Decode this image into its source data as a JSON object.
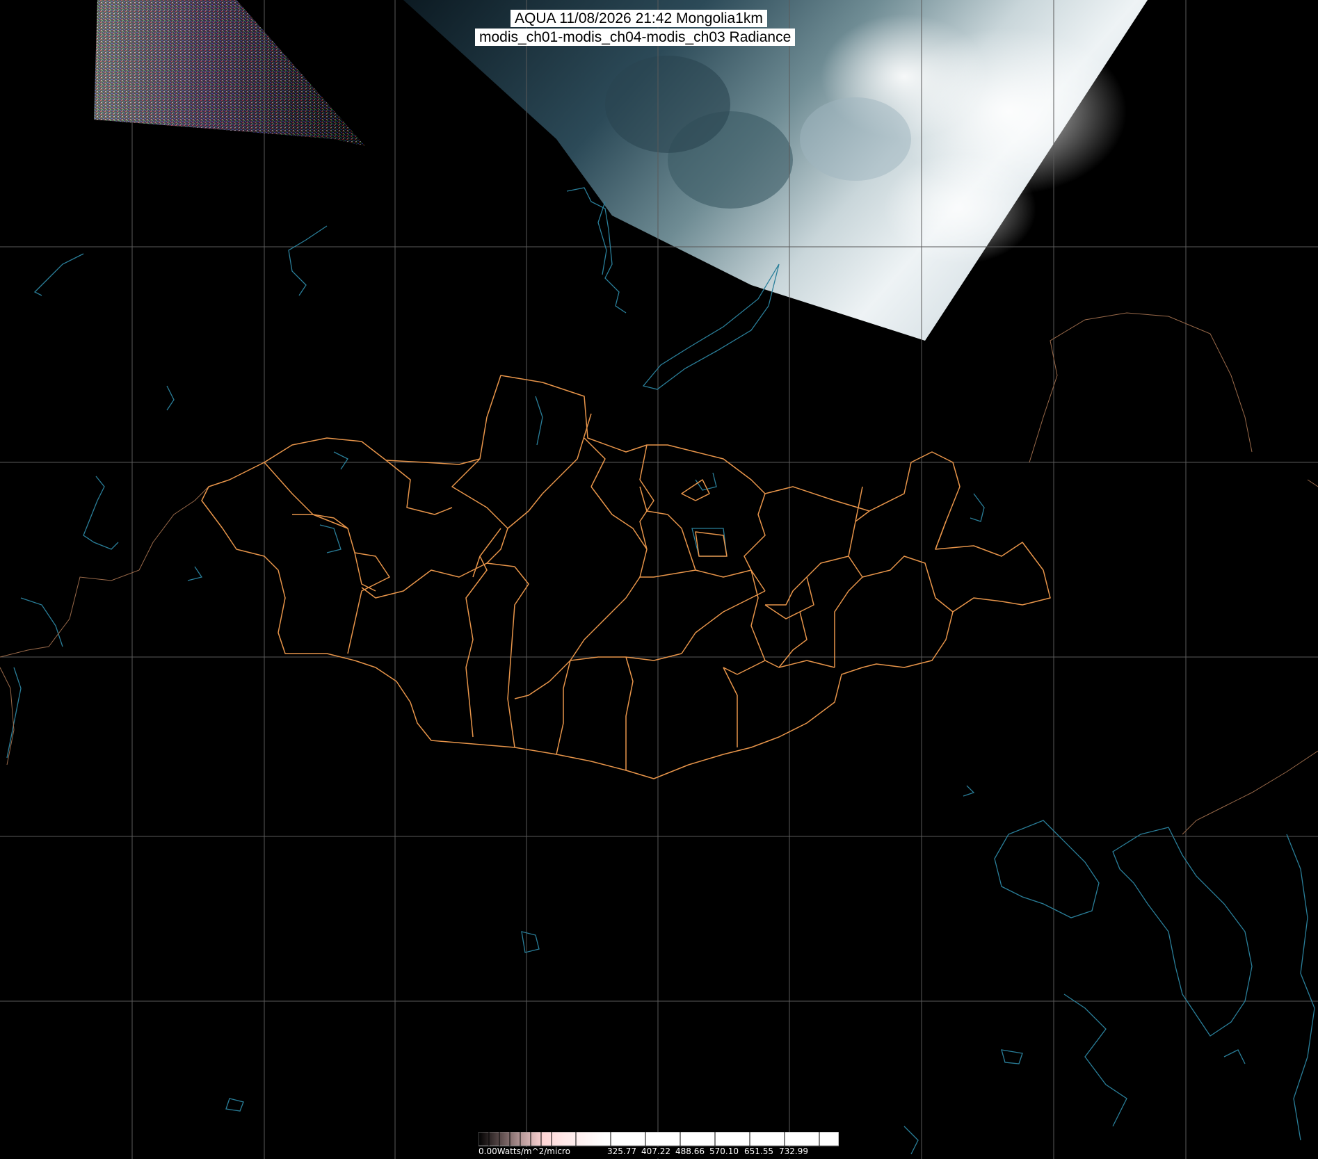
{
  "title": {
    "line1": "AQUA 11/08/2026 21:42 Mongolia1km",
    "line2": "modis_ch01-modis_ch04-modis_ch03 Radiance"
  },
  "colorbar": {
    "unit_label": "0.00Watts/m^2/micro",
    "tick_labels": [
      "325.77",
      "407.22",
      "488.66",
      "570.10",
      "651.55",
      "732.99"
    ],
    "gradient_colors": [
      "#000000",
      "#5a4a4a",
      "#b89a9a",
      "#ffd6d6",
      "#ffe8e8",
      "#ffffff"
    ]
  },
  "map": {
    "background_color": "#000000",
    "gridline_color": "#5a5a5a",
    "border_color": "#e8954a",
    "coast_color": "#2a7f9a",
    "neighbor_border_color": "#9a6a4a",
    "image_swath": "satellite-true-color-cloud-swath"
  }
}
